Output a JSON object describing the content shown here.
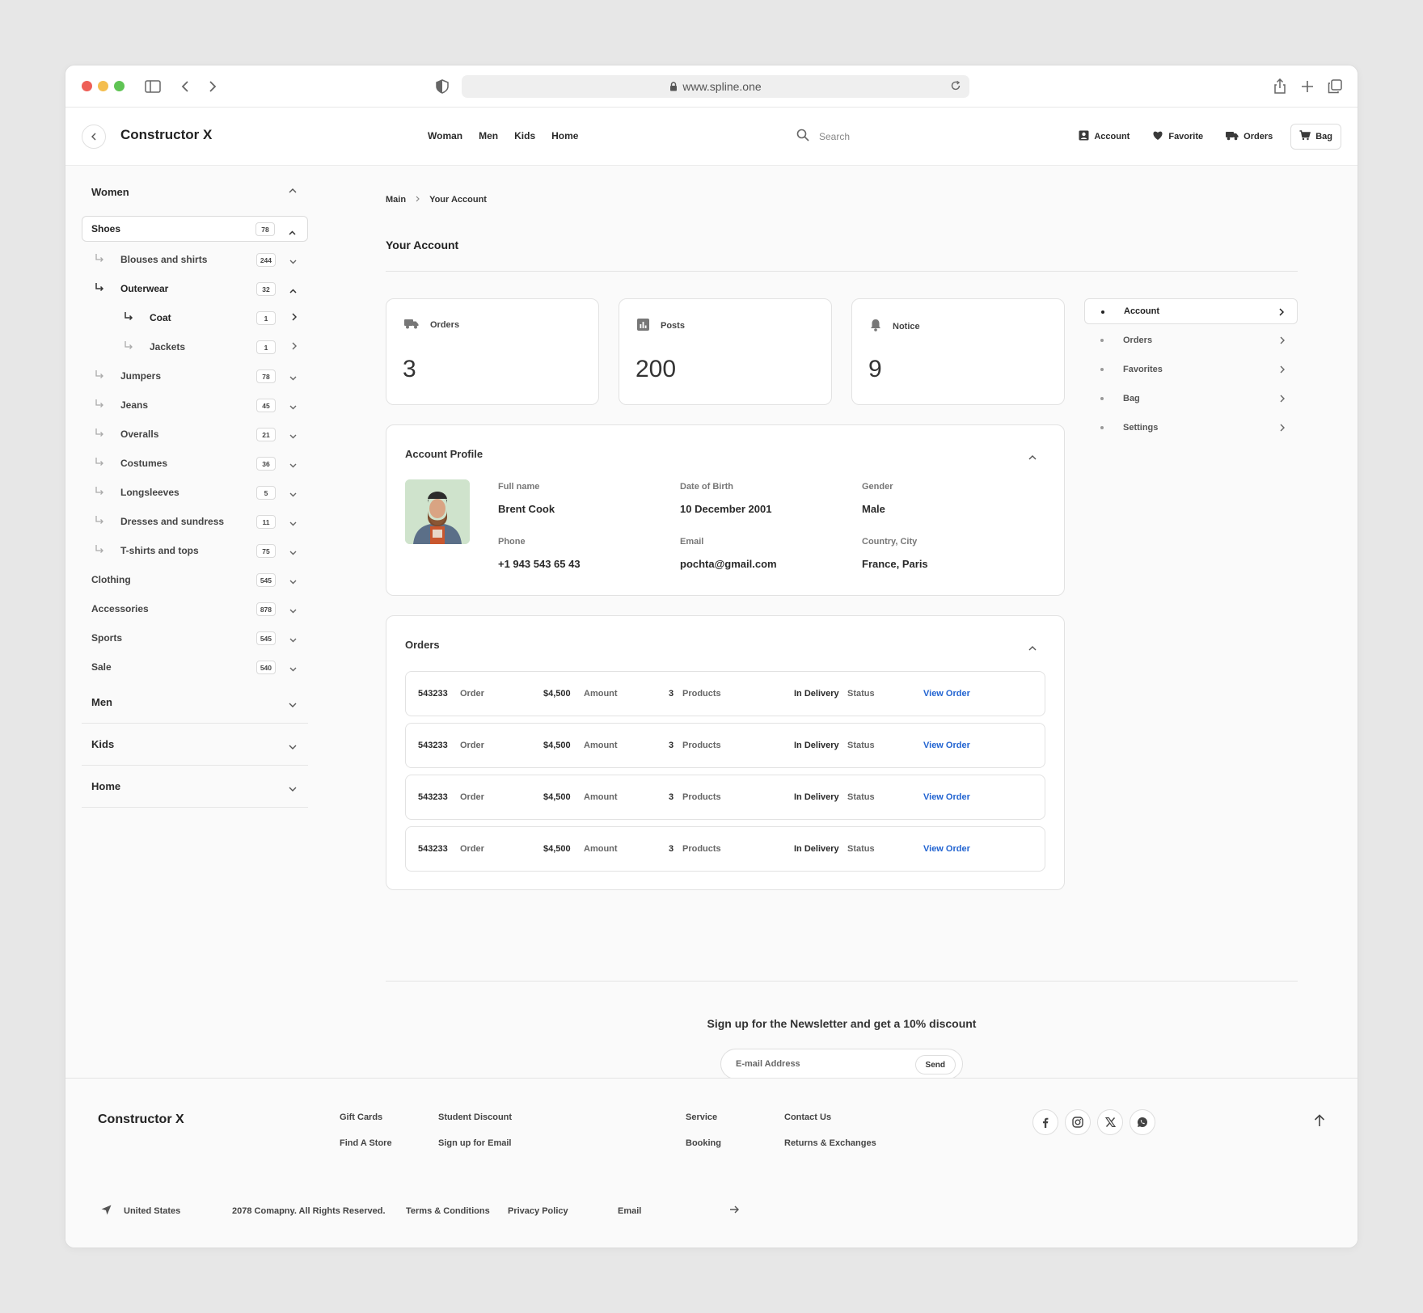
{
  "browser": {
    "url": "www.spline.one"
  },
  "header": {
    "brand": "Constructor X",
    "nav": [
      "Woman",
      "Men",
      "Kids",
      "Home"
    ],
    "search_placeholder": "Search",
    "actions": {
      "account": "Account",
      "favorite": "Favorite",
      "orders": "Orders",
      "bag": "Bag"
    }
  },
  "sidebar": {
    "women": "Women",
    "items": [
      {
        "label": "Shoes",
        "count": "78"
      },
      {
        "label": "Blouses and shirts",
        "count": "244"
      },
      {
        "label": "Outerwear",
        "count": "32"
      },
      {
        "label": "Coat",
        "count": "1"
      },
      {
        "label": "Jackets",
        "count": "1"
      },
      {
        "label": "Jumpers",
        "count": "78"
      },
      {
        "label": "Jeans",
        "count": "45"
      },
      {
        "label": "Overalls",
        "count": "21"
      },
      {
        "label": "Costumes",
        "count": "36"
      },
      {
        "label": "Longsleeves",
        "count": "5"
      },
      {
        "label": "Dresses and sundress",
        "count": "11"
      },
      {
        "label": "T-shirts and tops",
        "count": "75"
      },
      {
        "label": "Clothing",
        "count": "545"
      },
      {
        "label": "Accessories",
        "count": "878"
      },
      {
        "label": "Sports",
        "count": "545"
      },
      {
        "label": "Sale",
        "count": "540"
      }
    ],
    "groups": [
      "Men",
      "Kids",
      "Home"
    ]
  },
  "breadcrumb": {
    "root": "Main",
    "current": "Your Account"
  },
  "page_title": "Your Account",
  "stats": [
    {
      "label": "Orders",
      "value": "3"
    },
    {
      "label": "Posts",
      "value": "200"
    },
    {
      "label": "Notice",
      "value": "9"
    }
  ],
  "account_menu": [
    "Account",
    "Orders",
    "Favorites",
    "Bag",
    "Settings"
  ],
  "profile": {
    "title": "Account Profile",
    "full_name_label": "Full name",
    "full_name": "Brent Cook",
    "dob_label": "Date of Birth",
    "dob": "10 December 2001",
    "gender_label": "Gender",
    "gender": "Male",
    "phone_label": "Phone",
    "phone": "+1 943 543 65 43",
    "email_label": "Email",
    "email": "pochta@gmail.com",
    "location_label": "Country, City",
    "location": "France, Paris"
  },
  "orders": {
    "title": "Orders",
    "order_label": "Order",
    "amount_label": "Amount",
    "products_label": "Products",
    "status_label": "Status",
    "view_label": "View Order",
    "rows": [
      {
        "id": "543233",
        "amount": "$4,500",
        "products": "3",
        "status": "In Delivery"
      },
      {
        "id": "543233",
        "amount": "$4,500",
        "products": "3",
        "status": "In Delivery"
      },
      {
        "id": "543233",
        "amount": "$4,500",
        "products": "3",
        "status": "In Delivery"
      },
      {
        "id": "543233",
        "amount": "$4,500",
        "products": "3",
        "status": "In Delivery"
      }
    ]
  },
  "newsletter": {
    "title": "Sign up for the Newsletter and get a 10% discount",
    "placeholder": "E-mail Address",
    "send": "Send"
  },
  "footer": {
    "brand": "Constructor X",
    "links": [
      "Gift Cards",
      "Find A Store",
      "Student Discount",
      "Sign up for Email",
      "Service",
      "Booking",
      "Contact Us",
      "Returns & Exchanges"
    ],
    "country": "United States",
    "copyright": "2078 Comapny. All Rights Reserved.",
    "terms": "Terms & Conditions",
    "privacy": "Privacy Policy",
    "email": "Email"
  },
  "colors": {
    "accent_link": "#2264d1"
  }
}
